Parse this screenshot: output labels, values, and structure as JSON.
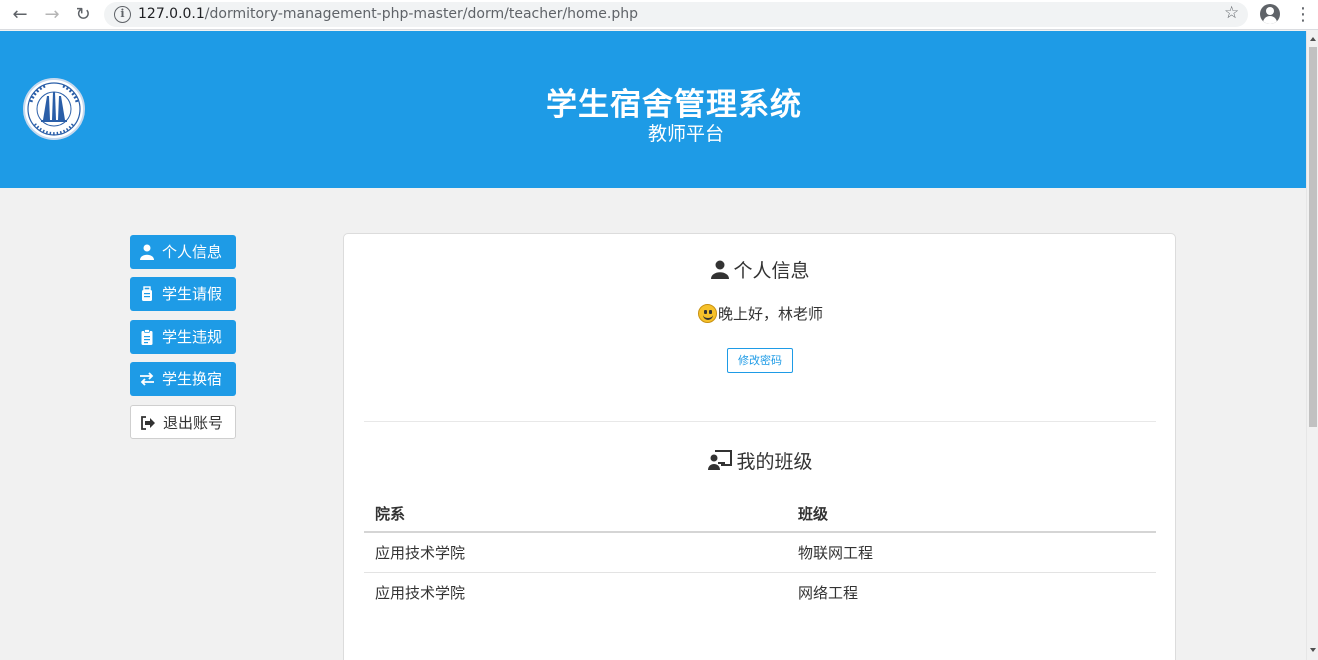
{
  "browser": {
    "url_host": "127.0.0.1",
    "url_path": "/dormitory-management-php-master/dorm/teacher/home.php"
  },
  "header": {
    "title": "学生宿舍管理系统",
    "subtitle": "教师平台",
    "brand_color": "#1e9be6"
  },
  "sidebar": {
    "items": [
      {
        "label": "个人信息",
        "icon": "user-icon"
      },
      {
        "label": "学生请假",
        "icon": "suitcase-icon"
      },
      {
        "label": "学生违规",
        "icon": "clipboard-icon"
      },
      {
        "label": "学生换宿",
        "icon": "exchange-icon"
      },
      {
        "label": "退出账号",
        "icon": "sign-out-icon"
      }
    ]
  },
  "profile": {
    "title": "个人信息",
    "greeting": "晚上好，林老师",
    "change_password_label": "修改密码"
  },
  "classes": {
    "title": "我的班级",
    "columns": [
      "院系",
      "班级"
    ],
    "rows": [
      [
        "应用技术学院",
        "物联网工程"
      ],
      [
        "应用技术学院",
        "网络工程"
      ]
    ]
  }
}
